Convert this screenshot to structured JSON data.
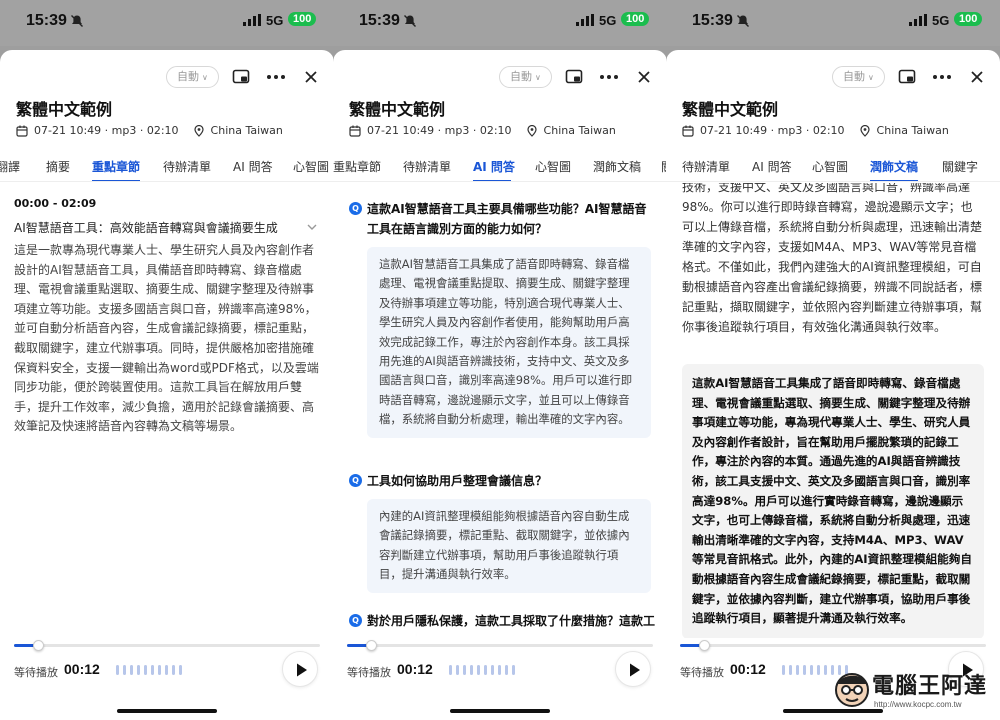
{
  "status": {
    "time": "15:39",
    "network": "5G",
    "battery": "100"
  },
  "header": {
    "auto_label": "自動",
    "title": "繁體中文範例",
    "date_meta": "07-21 10:49 · mp3 · 02:10",
    "location": "China Taiwan"
  },
  "tabs_p1": [
    "翻譯",
    "摘要",
    "重點章節",
    "待辦清單",
    "AI 問答",
    "心智圖"
  ],
  "tabs_p2": [
    "重點章節",
    "待辦清單",
    "AI 問答",
    "心智圖",
    "潤飾文稿",
    "關"
  ],
  "tabs_p3": [
    "待辦清單",
    "AI 問答",
    "心智圖",
    "潤飾文稿",
    "關鍵字"
  ],
  "panel1": {
    "segment_time": "00:00 - 02:09",
    "segment_title": "AI智慧語音工具：高效能語音轉寫與會議摘要生成",
    "segment_body": "這是一款專為現代專業人士、學生研究人員及內容創作者設計的AI智慧語音工具，具備語音即時轉寫、錄音檔處理、電視會議重點選取、摘要生成、關鍵字整理及待辦事項建立等功能。支援多國語言與口音，辨識率高達98%，並可自動分析語音內容，生成會議記錄摘要，標記重點，截取關鍵字，建立代辦事項。同時，提供嚴格加密措施確保資料安全，支援一鍵輸出為word或PDF格式，以及雲端同步功能，便於跨裝置使用。這款工具旨在解放用戶雙手，提升工作效率，減少負擔，適用於記錄會議摘要、高效筆記及快速將語音內容轉為文稿等場景。"
  },
  "panel2": {
    "badge": "Q",
    "qa": [
      {
        "q": "這款AI智慧語音工具主要具備哪些功能？AI智慧語音工具在語言識別方面的能力如何？",
        "a": "這款AI智慧語音工具集成了語音即時轉寫、錄音檔處理、電視會議重點提取、摘要生成、關鍵字整理及待辦事項建立等功能，特別適合現代專業人士、學生研究人員及內容創作者使用，能夠幫助用戶高效完成記錄工作，專注於內容創作本身。該工具採用先進的AI與語音辨識技術，支持中文、英文及多國語言與口音，識別率高達98%。用戶可以進行即時語音轉寫，邊說邊顯示文字，並且可以上傳錄音檔，系統將自動分析處理，輸出準確的文字內容。"
      },
      {
        "q": "工具如何協助用戶整理會議信息？",
        "a": "內建的AI資訊整理模組能夠根據語音內容自動生成會議記錄摘要，標記重點、截取關鍵字，並依據內容判斷建立代辦事項，幫助用戶事後追蹤執行項目，提升溝通與執行效率。"
      },
      {
        "q": "對於用戶隱私保護，這款工具採取了什麼措施？這款工",
        "a": ""
      }
    ]
  },
  "panel3": {
    "body": "技術，支援中文、英文及多國語言與口音，辨識率高達98%。你可以進行即時錄音轉寫，邊說邊顯示文字；也可以上傳錄音檔，系統將自動分析與處理，迅速輸出清楚準確的文字內容，支援如M4A、MP3、WAV等常見音檔格式。不僅如此，我們內建強大的AI資訊整理模組，可自動根據語音內容產出會議紀錄摘要，辨識不同說話者，標記重點，擷取關鍵字，並依照內容判斷建立待辦事項，幫你事後追蹤執行項目，有效強化溝通與執行效率。",
    "polished": "這款AI智慧語音工具集成了語音即時轉寫、錄音檔處理、電視會議重點選取、摘要生成、關鍵字整理及待辦事項建立等功能，專為現代專業人士、學生、研究人員及內容創作者設計，旨在幫助用戶擺脫繁瑣的記錄工作，專注於內容的本質。通過先進的AI與語音辨識技術，該工具支援中文、英文及多國語言與口音，識別率高達98%。用戶可以進行實時錄音轉寫，邊說邊顯示文字，也可上傳錄音檔，系統將自動分析與處理，迅速輸出清晰準確的文字內容，支持M4A、MP3、WAV等常見音訊格式。此外，內建的AI資訊整理模組能夠自動根據語音內容生成會議紀錄摘要，標記重點，截取關鍵字，並依據內容判斷，建立代辦事項，協助用戶事後追蹤執行項目，顯著提升溝通及執行效率。"
  },
  "player": {
    "wait_label": "等待播放",
    "current_time": "00:12",
    "progress": 0.08
  },
  "watermark": {
    "text": "電腦王阿達",
    "url": "http://www.kocpc.com.tw"
  },
  "colors": {
    "accent": "#1a56d6",
    "battery": "#1bbd4e",
    "answer_bg": "#f1f5fb"
  }
}
